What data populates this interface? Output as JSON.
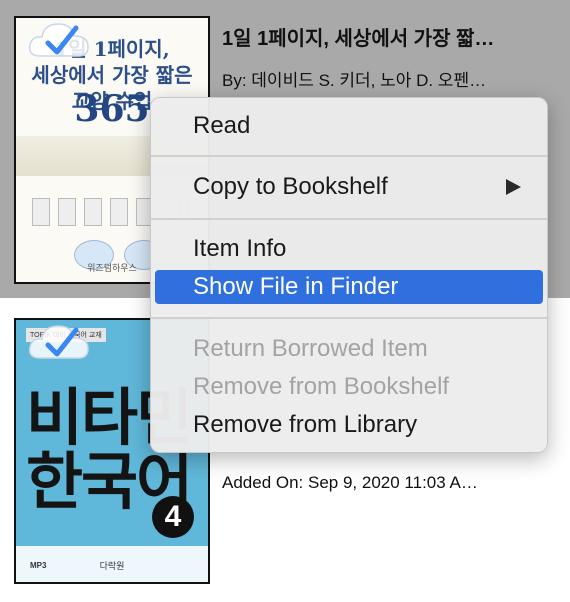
{
  "books": [
    {
      "title": "1일 1페이지, 세상에서 가장 짧…",
      "author": "By: 데이비드 S. 키더, 노아 D. 오펜…",
      "cover": {
        "title_lines": "1일 1페이지,\n세상에서 가장 짧은\n교양 수업",
        "big_number": "365",
        "publisher": "위즈덤하우스"
      }
    },
    {
      "added_on": "Added On: Sep 9, 2020 11:03 A…",
      "cover": {
        "badge": "TOPIK 대비 한국어 교재",
        "big_text": "비타민\n한국어",
        "number": "4",
        "mp3": "MP3",
        "publisher": "다락원"
      }
    }
  ],
  "context_menu": {
    "items": [
      {
        "label": "Read"
      },
      {
        "label": "Copy to Bookshelf"
      },
      {
        "label": "Item Info"
      },
      {
        "label": "Show File in Finder"
      },
      {
        "label": "Return Borrowed Item"
      },
      {
        "label": "Remove from Bookshelf"
      },
      {
        "label": "Remove from Library"
      }
    ]
  },
  "colors": {
    "selection": "#a9a9a9",
    "highlight": "#2f6fde",
    "check": "#3b86f0"
  }
}
